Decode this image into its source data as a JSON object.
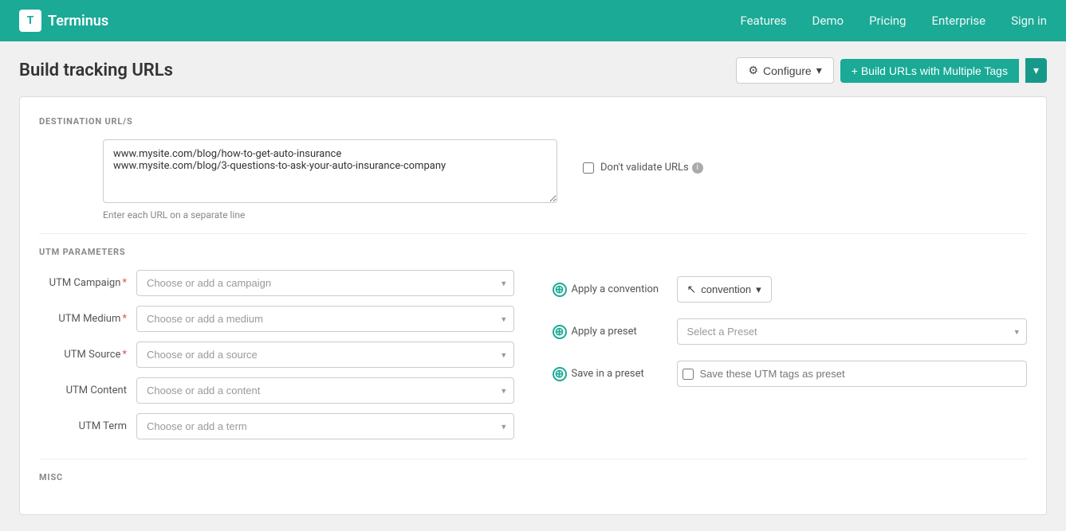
{
  "nav": {
    "logo_text": "T",
    "brand_name": "Terminus",
    "links": [
      {
        "label": "Features",
        "id": "features"
      },
      {
        "label": "Demo",
        "id": "demo"
      },
      {
        "label": "Pricing",
        "id": "pricing"
      },
      {
        "label": "Enterprise",
        "id": "enterprise"
      },
      {
        "label": "Sign in",
        "id": "signin"
      }
    ]
  },
  "page": {
    "title": "Build tracking URLs",
    "configure_label": "Configure",
    "build_label": "+ Build URLs with Multiple Tags"
  },
  "destination": {
    "section_label": "DESTINATION URL/S",
    "url_content": "www.mysite.com/blog/how-to-get-auto-insurance\nwww.mysite.com/blog/3-questions-to-ask-your-auto-insurance-company",
    "url_hint": "Enter each URL on a separate line",
    "validate_label": "Don't validate URLs"
  },
  "utm": {
    "section_label": "UTM PARAMETERS",
    "fields": [
      {
        "label": "UTM Campaign",
        "required": true,
        "placeholder": "Choose or add a campaign",
        "id": "campaign"
      },
      {
        "label": "UTM Medium",
        "required": true,
        "placeholder": "Choose or add a medium",
        "id": "medium"
      },
      {
        "label": "UTM Source",
        "required": true,
        "placeholder": "Choose or add a source",
        "id": "source"
      },
      {
        "label": "UTM Content",
        "required": false,
        "placeholder": "Choose or add a content",
        "id": "content"
      },
      {
        "label": "UTM Term",
        "required": false,
        "placeholder": "Choose or add a term",
        "id": "term"
      }
    ],
    "convention": {
      "apply_label": "Apply a convention",
      "button_label": "convention"
    },
    "preset": {
      "apply_label": "Apply a preset",
      "select_placeholder": "Select a Preset"
    },
    "save_preset": {
      "label": "Save in a preset",
      "input_placeholder": "Save these UTM tags as preset"
    }
  },
  "misc": {
    "section_label": "MISC"
  }
}
